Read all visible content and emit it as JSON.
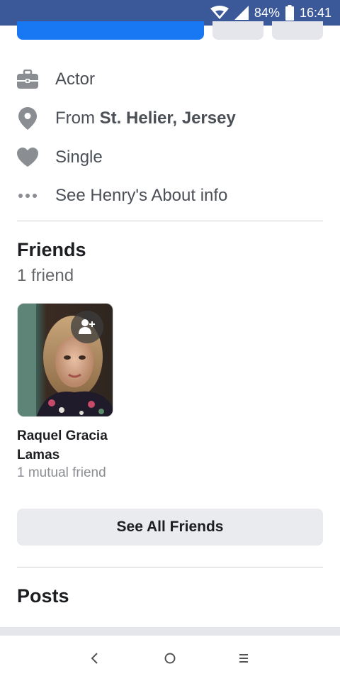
{
  "status_bar": {
    "battery": "84%",
    "time": "16:41",
    "icons": [
      "wifi-icon",
      "signal-icon",
      "battery-icon"
    ]
  },
  "about": {
    "work": "Actor",
    "from_prefix": "From ",
    "from_place": "St. Helier, Jersey",
    "relationship": "Single",
    "about_link": "See Henry's About info"
  },
  "friends": {
    "title": "Friends",
    "count": "1 friend",
    "items": [
      {
        "name": "Raquel Gracia Lamas",
        "mutual": "1 mutual friend"
      }
    ],
    "see_all": "See All Friends"
  },
  "posts": {
    "title": "Posts"
  },
  "colors": {
    "status_bar": "#3b5998",
    "primary": "#1877f2",
    "icon_gray": "#8a8d91"
  },
  "nav_icons": [
    "back-icon",
    "home-icon",
    "recents-icon"
  ]
}
